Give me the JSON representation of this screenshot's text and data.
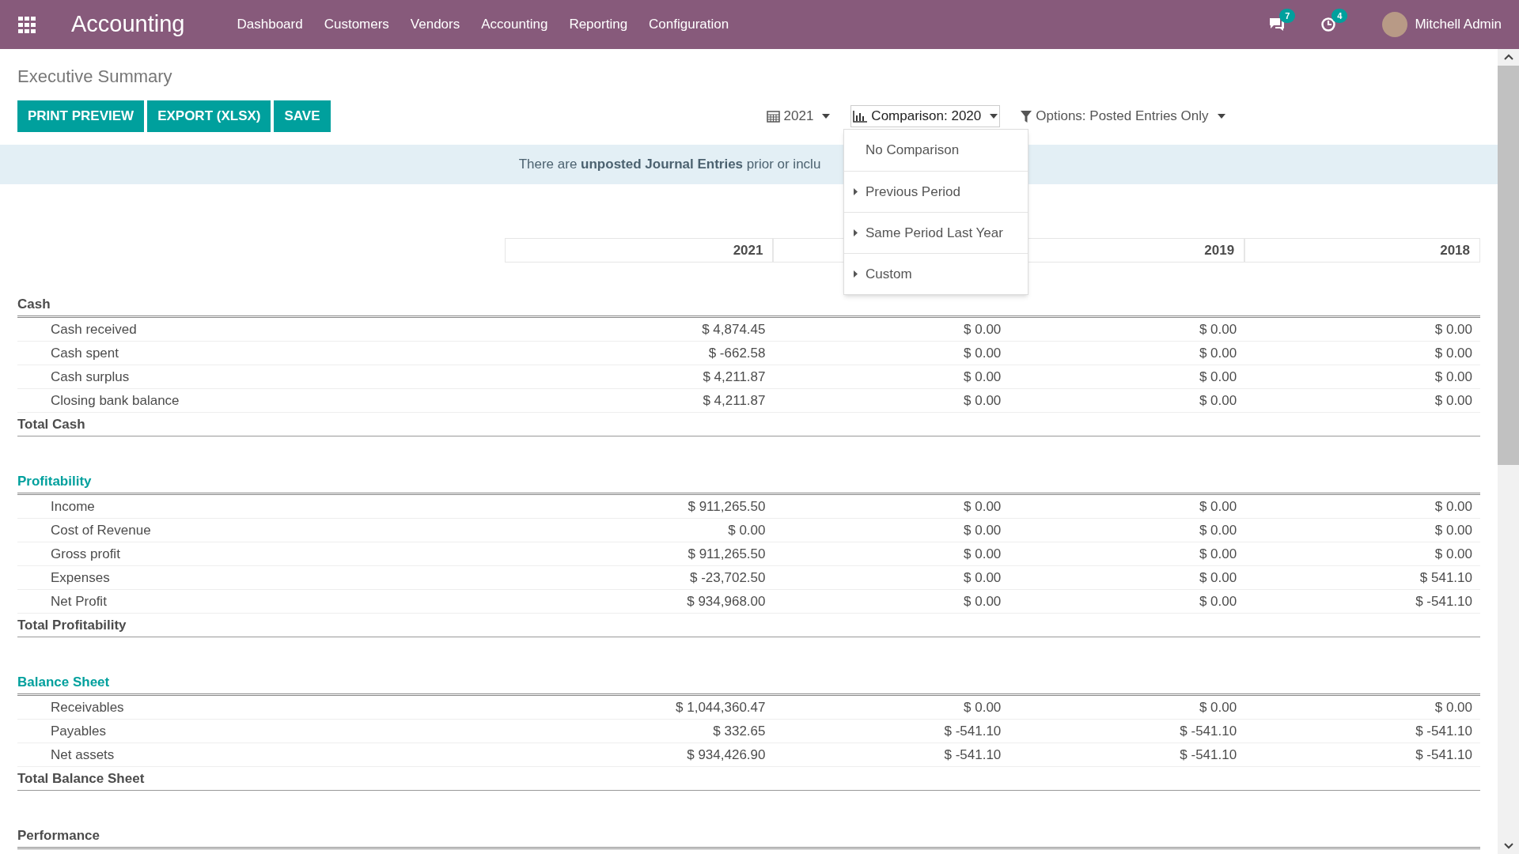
{
  "navbar": {
    "app_title": "Accounting",
    "menu": [
      "Dashboard",
      "Customers",
      "Vendors",
      "Accounting",
      "Reporting",
      "Configuration"
    ],
    "messages_badge": "7",
    "activities_badge": "4",
    "user": "Mitchell Admin"
  },
  "page_title": "Executive Summary",
  "buttons": [
    "PRINT PREVIEW",
    "EXPORT (XLSX)",
    "SAVE"
  ],
  "filters": [
    {
      "kind": "date",
      "label": "2021",
      "open": false
    },
    {
      "kind": "comparison",
      "label": "Comparison: 2020",
      "open": true
    },
    {
      "kind": "options",
      "label": "Options: Posted Entries Only",
      "open": false
    }
  ],
  "comparison_menu": [
    {
      "label": "No Comparison",
      "submenu": false
    },
    {
      "label": "Previous Period",
      "submenu": true
    },
    {
      "label": "Same Period Last Year",
      "submenu": true
    },
    {
      "label": "Custom",
      "submenu": true
    }
  ],
  "banner": "There are **unposted Journal Entries** prior or inclu",
  "table": {
    "columns": [
      {
        "label": "2021"
      },
      {},
      {
        "label": "2019"
      },
      {
        "label": "2018"
      }
    ],
    "sections": [
      {
        "title": "Cash",
        "kind": "plain",
        "rows": [
          {
            "label": "Cash received",
            "values": [
              "$ 4,874.45",
              "$ 0.00",
              "$ 0.00",
              "$ 0.00"
            ]
          },
          {
            "label": "Cash spent",
            "values": [
              "$ -662.58",
              "$ 0.00",
              "$ 0.00",
              "$ 0.00"
            ]
          },
          {
            "label": "Cash surplus",
            "values": [
              "$ 4,211.87",
              "$ 0.00",
              "$ 0.00",
              "$ 0.00"
            ]
          },
          {
            "label": "Closing bank balance",
            "values": [
              "$ 4,211.87",
              "$ 0.00",
              "$ 0.00",
              "$ 0.00"
            ]
          }
        ],
        "total": "Total Cash"
      },
      {
        "title": "Profitability",
        "kind": "link",
        "rows": [
          {
            "label": "Income",
            "values": [
              "$ 911,265.50",
              "$ 0.00",
              "$ 0.00",
              "$ 0.00"
            ]
          },
          {
            "label": "Cost of Revenue",
            "values": [
              "$ 0.00",
              "$ 0.00",
              "$ 0.00",
              "$ 0.00"
            ]
          },
          {
            "label": "Gross profit",
            "values": [
              "$ 911,265.50",
              "$ 0.00",
              "$ 0.00",
              "$ 0.00"
            ]
          },
          {
            "label": "Expenses",
            "values": [
              "$ -23,702.50",
              "$ 0.00",
              "$ 0.00",
              "$ 541.10"
            ]
          },
          {
            "label": "Net Profit",
            "values": [
              "$ 934,968.00",
              "$ 0.00",
              "$ 0.00",
              "$ -541.10"
            ]
          }
        ],
        "total": "Total Profitability"
      },
      {
        "title": "Balance Sheet",
        "kind": "link",
        "rows": [
          {
            "label": "Receivables",
            "values": [
              "$ 1,044,360.47",
              "$ 0.00",
              "$ 0.00",
              "$ 0.00"
            ]
          },
          {
            "label": "Payables",
            "values": [
              "$ 332.65",
              "$ -541.10",
              "$ -541.10",
              "$ -541.10"
            ]
          },
          {
            "label": "Net assets",
            "values": [
              "$ 934,426.90",
              "$ -541.10",
              "$ -541.10",
              "$ -541.10"
            ]
          }
        ],
        "total": "Total Balance Sheet"
      },
      {
        "title": "Performance",
        "kind": "plain"
      }
    ]
  }
}
